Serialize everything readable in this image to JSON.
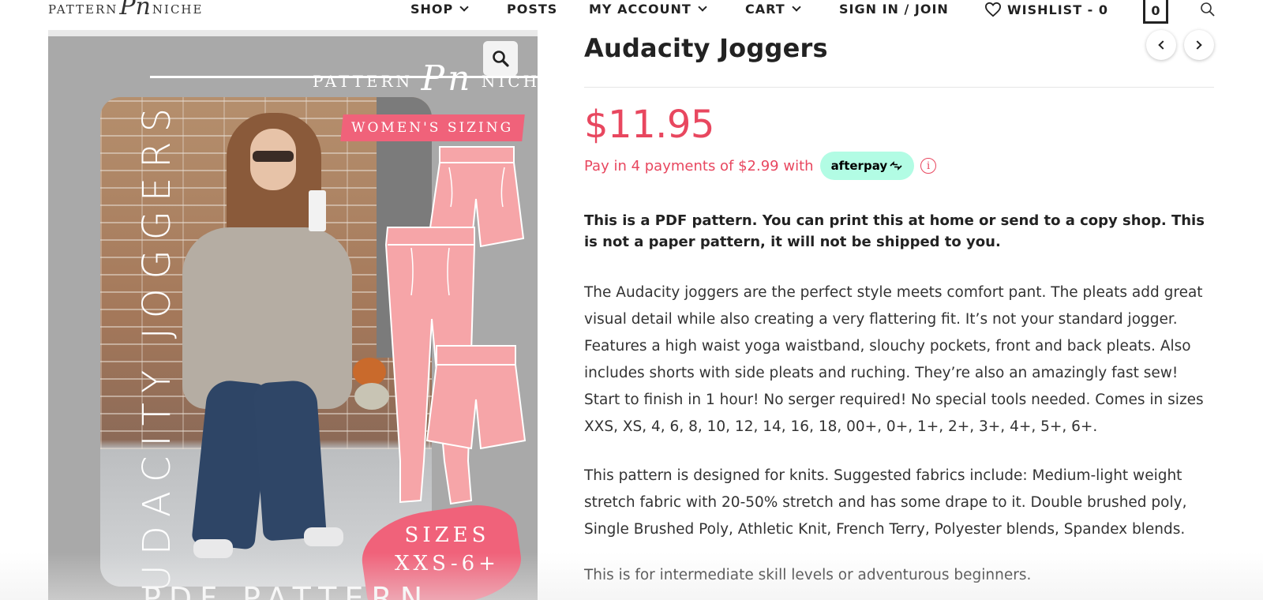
{
  "header": {
    "logo": {
      "word_left": "PATTERN",
      "mark": "Pn",
      "word_right": "NICHE"
    },
    "nav": [
      {
        "label": "SHOP",
        "has_dropdown": true
      },
      {
        "label": "POSTS",
        "has_dropdown": false
      },
      {
        "label": "MY ACCOUNT",
        "has_dropdown": true
      },
      {
        "label": "CART",
        "has_dropdown": true
      },
      {
        "label": "SIGN IN / JOIN",
        "has_dropdown": false
      },
      {
        "label": "WISHLIST - 0",
        "has_dropdown": false,
        "icon": "heart-icon"
      }
    ],
    "cart_count": "0",
    "search_icon": "search-icon"
  },
  "product_image": {
    "logo_word_left": "PATTERN",
    "logo_mark": "Pn",
    "logo_word_right": "NICHE",
    "vertical_title": "AUDACITY JOGGERS",
    "tag": "WOMEN'S SIZING",
    "sizes_line1": "SIZES",
    "sizes_line2": "XXS-6+",
    "bottom_text": "PDF PATTERN",
    "zoom_icon": "zoom-icon"
  },
  "product": {
    "title": "Audacity Joggers",
    "price": "$11.95",
    "afterpay_text": "Pay in 4 payments of $2.99 with",
    "afterpay_badge": "afterpay",
    "info_glyph": "i",
    "bold_notice": "This is a PDF pattern. You can print this at home or send to a copy shop. This is not a paper pattern, it will not be shipped to you.",
    "description_1": "The Audacity joggers are the perfect style meets comfort pant. The pleats add great visual detail while also creating a very flattering fit. It’s not your standard jogger. Features a high waist yoga waistband, slouchy pockets, front and back pleats. Also includes shorts with side pleats and ruching. They’re also an amazingly fast sew! Start to finish in 1 hour! No serger required! No special tools needed. Comes in sizes XXS, XS, 4, 6, 8, 10, 12, 14, 16, 18, 00+, 0+, 1+, 2+, 3+, 4+, 5+, 6+.",
    "description_2": "This pattern is designed for knits. Suggested fabrics include: Medium-light weight stretch fabric with 20-50% stretch and has some drape to it. Double brushed poly, Single Brushed Poly, Athletic Knit, French Terry, Polyester blends, Spandex blends.",
    "description_3": "This is for intermediate skill levels or adventurous beginners."
  },
  "colors": {
    "accent": "#e8475f",
    "afterpay_mint": "#b2fce4",
    "image_gray": "#a9a9a9",
    "pink_drawing": "#f6a5a8"
  }
}
